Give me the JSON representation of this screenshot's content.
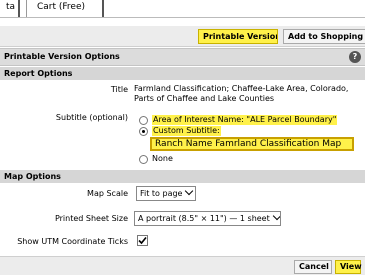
{
  "tabs": {
    "left_label": "ta",
    "cart_label": "Cart (Free)"
  },
  "toolbar": {
    "printable_label": "Printable Version",
    "shopping_label": "Add to Shopping C"
  },
  "dialog": {
    "title": "Printable Version Options",
    "help_icon": "?",
    "report_section": "Report Options",
    "title_label": "Title",
    "title_value": "Farmland Classification; Chaffee-Lake Area, Colorado, Parts of Chaffee and Lake Counties",
    "subtitle_label": "Subtitle (optional)",
    "subtitle_options": [
      {
        "label": "Area of Interest Name: \"ALE Parcel Boundary\"",
        "selected": false
      },
      {
        "label": "Custom Subtitle:",
        "selected": true
      },
      {
        "label": "None",
        "selected": false
      }
    ],
    "custom_subtitle_value": "Ranch Name Famrland Classification Map",
    "map_section": "Map Options",
    "map_scale_label": "Map Scale",
    "map_scale_value": "Fit to page",
    "sheet_size_label": "Printed Sheet Size",
    "sheet_size_value": "A portrait (8.5\" × 11\") — 1 sheet",
    "utm_label": "Show UTM Coordinate Ticks",
    "utm_checked": true
  },
  "footer": {
    "cancel_label": "Cancel",
    "view_label": "View"
  },
  "colors": {
    "highlight": "#fff14a",
    "title_bar": "#dcdcdc",
    "section_bar": "#d6d6d6",
    "accent_border": "#c8a000"
  }
}
